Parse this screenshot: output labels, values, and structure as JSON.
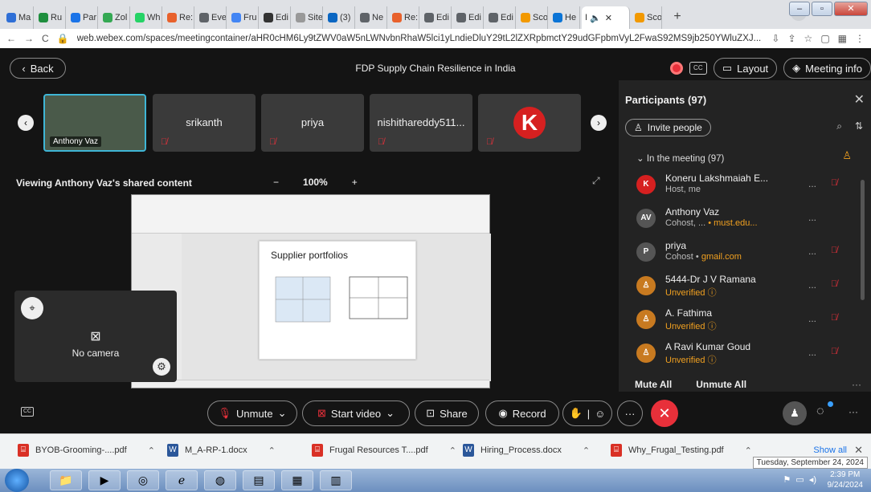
{
  "browser": {
    "tabs": [
      {
        "label": "Ma",
        "color": "#2f6fd6"
      },
      {
        "label": "Ru",
        "color": "#1e8e3e"
      },
      {
        "label": "Par",
        "color": "#1a73e8"
      },
      {
        "label": "Zol",
        "color": "#34a853"
      },
      {
        "label": "Wh",
        "color": "#25d366"
      },
      {
        "label": "Re:",
        "color": "#e8612c"
      },
      {
        "label": "Eve",
        "color": "#5f6368"
      },
      {
        "label": "Fru",
        "color": "#4285f4"
      },
      {
        "label": "Edi",
        "color": "#333333"
      },
      {
        "label": "Site is",
        "color": "#999999"
      },
      {
        "label": "(3)",
        "color": "#0a66c2"
      },
      {
        "label": "Ne",
        "color": "#5f6368"
      },
      {
        "label": "Re:",
        "color": "#e8612c"
      },
      {
        "label": "Edi",
        "color": "#5f6368"
      },
      {
        "label": "Edi",
        "color": "#5f6368"
      },
      {
        "label": "Edi",
        "color": "#5f6368"
      },
      {
        "label": "Sco",
        "color": "#f29900"
      },
      {
        "label": "He",
        "color": "#0b74d6"
      }
    ],
    "active_tab": {
      "label": "I",
      "color": "#1a1a1a"
    },
    "extra_tab": {
      "label": "Sco",
      "color": "#f29900"
    },
    "url": "web.webex.com/spaces/meetingcontainer/aHR0cHM6Ly9tZWV0aW5nLWNvbnRhaW5lci1yLndieDluY29tL2lZXRpbmctY29udGFpbmVyL2FwaS92MS9jb250YWluZXJ..."
  },
  "meeting": {
    "back_label": "Back",
    "title": "FDP Supply Chain Resilience in India",
    "layout_label": "Layout",
    "info_label": "Meeting info",
    "tiles": [
      {
        "name": "Anthony Vaz",
        "type": "video"
      },
      {
        "name": "srikanth"
      },
      {
        "name": "priya"
      },
      {
        "name": "nishithareddy511..."
      },
      {
        "name": "",
        "type": "logo",
        "logo": "K"
      }
    ],
    "viewing_label": "Viewing Anthony Vaz's shared content",
    "zoom_minus": "−",
    "zoom_value": "100%",
    "zoom_plus": "+",
    "slide_title": "Supplier portfolios",
    "no_camera": "No camera"
  },
  "participants": {
    "title": "Participants (97)",
    "invite": "Invite people",
    "section": "In the meeting (97)",
    "list": [
      {
        "name": "Koneru Lakshmaiah E...",
        "sub": "Host, me",
        "sub_hl": "",
        "avatar": "K",
        "color": "#d62020",
        "more": "...",
        "mic": true
      },
      {
        "name": "Anthony Vaz",
        "sub": "Cohost, ...",
        "sub_hl": "• must.edu...",
        "avatar": "AV",
        "color": "#555555",
        "more": "...",
        "mic": false
      },
      {
        "name": "priya",
        "sub": "Cohost •",
        "sub_hl": "gmail.com",
        "avatar": "P",
        "color": "#555555",
        "more": "...",
        "mic": true
      },
      {
        "name": "5444-Dr J V Ramana",
        "sub": "",
        "sub_hl": "Unverified ⓘ",
        "avatar": "♙",
        "color": "#c87a20",
        "more": "...",
        "mic": true
      },
      {
        "name": "A. Fathima",
        "sub": "",
        "sub_hl": "Unverified ⓘ",
        "avatar": "♙",
        "color": "#c87a20",
        "more": "...",
        "mic": true
      },
      {
        "name": "A Ravi Kumar Goud",
        "sub": "",
        "sub_hl": "Unverified ⓘ",
        "avatar": "♙",
        "color": "#c87a20",
        "more": "...",
        "mic": true
      }
    ],
    "mute_all": "Mute All",
    "unmute_all": "Unmute All"
  },
  "controls": {
    "unmute": "Unmute",
    "start_video": "Start video",
    "share": "Share",
    "record": "Record"
  },
  "downloads": [
    {
      "name": "BYOB-Grooming-....pdf",
      "kind": "pdf"
    },
    {
      "name": "M_A-RP-1.docx",
      "kind": "doc"
    },
    {
      "name": "Frugal Resources T....pdf",
      "kind": "pdf"
    },
    {
      "name": "Hiring_Process.docx",
      "kind": "doc"
    },
    {
      "name": "Why_Frugal_Testing.pdf",
      "kind": "pdf"
    }
  ],
  "show_all": "Show all",
  "tooltip_date": "Tuesday, September 24, 2024",
  "clock": {
    "time": "2:39 PM",
    "date": "9/24/2024"
  }
}
